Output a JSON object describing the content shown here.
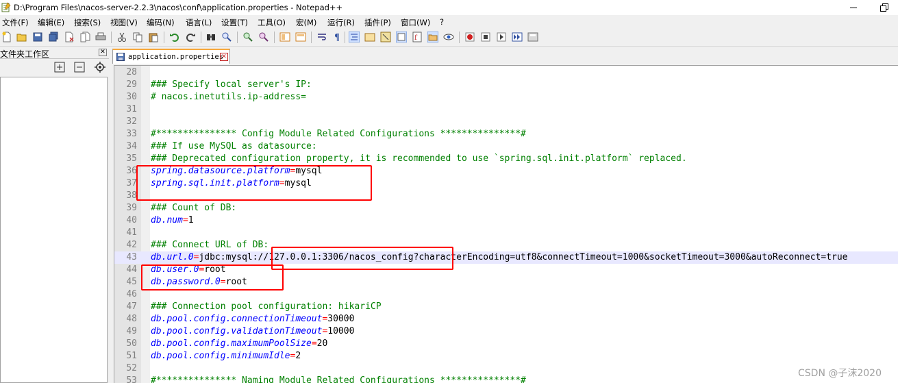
{
  "window": {
    "title": "D:\\Program Files\\nacos-server-2.2.3\\nacos\\conf\\application.properties - Notepad++"
  },
  "menu": [
    "文件(F)",
    "编辑(E)",
    "搜索(S)",
    "视图(V)",
    "编码(N)",
    "语言(L)",
    "设置(T)",
    "工具(O)",
    "宏(M)",
    "运行(R)",
    "插件(P)",
    "窗口(W)",
    "?"
  ],
  "panel": {
    "title": "文件夹工作区",
    "close": "✕"
  },
  "tab": {
    "label": "application.properties",
    "close": "✕"
  },
  "lines": [
    {
      "num": "28",
      "parts": []
    },
    {
      "num": "29",
      "parts": [
        {
          "t": "comment",
          "v": "### Specify local server's IP:"
        }
      ]
    },
    {
      "num": "30",
      "parts": [
        {
          "t": "comment",
          "v": "# nacos.inetutils.ip-address="
        }
      ]
    },
    {
      "num": "31",
      "parts": []
    },
    {
      "num": "32",
      "parts": []
    },
    {
      "num": "33",
      "parts": [
        {
          "t": "comment",
          "v": "#*************** Config Module Related Configurations ***************#"
        }
      ]
    },
    {
      "num": "34",
      "parts": [
        {
          "t": "comment",
          "v": "### If use MySQL as datasource:"
        }
      ]
    },
    {
      "num": "35",
      "parts": [
        {
          "t": "comment",
          "v": "### Deprecated configuration property, it is recommended to use `spring.sql.init.platform` replaced."
        }
      ]
    },
    {
      "num": "36",
      "parts": [
        {
          "t": "key",
          "v": "spring.datasource.platform"
        },
        {
          "t": "eq",
          "v": "="
        },
        {
          "t": "val",
          "v": "mysql"
        }
      ]
    },
    {
      "num": "37",
      "parts": [
        {
          "t": "key",
          "v": "spring.sql.init.platform"
        },
        {
          "t": "eq",
          "v": "="
        },
        {
          "t": "val",
          "v": "mysql"
        }
      ]
    },
    {
      "num": "38",
      "parts": []
    },
    {
      "num": "39",
      "parts": [
        {
          "t": "comment",
          "v": "### Count of DB:"
        }
      ]
    },
    {
      "num": "40",
      "parts": [
        {
          "t": "key",
          "v": "db.num"
        },
        {
          "t": "eq",
          "v": "="
        },
        {
          "t": "val",
          "v": "1"
        }
      ]
    },
    {
      "num": "41",
      "parts": []
    },
    {
      "num": "42",
      "parts": [
        {
          "t": "comment",
          "v": "### Connect URL of DB:"
        }
      ]
    },
    {
      "num": "43",
      "hl": true,
      "parts": [
        {
          "t": "key",
          "v": "db.url.0"
        },
        {
          "t": "eq",
          "v": "="
        },
        {
          "t": "val",
          "v": "jdbc:mysql://127.0.0.1:3306/nacos_config?characterEncoding=utf8&connectTimeout=1000&socketTimeout=3000&autoReconnect=true"
        }
      ]
    },
    {
      "num": "44",
      "parts": [
        {
          "t": "key",
          "v": "db.user.0"
        },
        {
          "t": "eq",
          "v": "="
        },
        {
          "t": "val",
          "v": "root"
        }
      ]
    },
    {
      "num": "45",
      "parts": [
        {
          "t": "key",
          "v": "db.password.0"
        },
        {
          "t": "eq",
          "v": "="
        },
        {
          "t": "val",
          "v": "root"
        }
      ]
    },
    {
      "num": "46",
      "parts": []
    },
    {
      "num": "47",
      "parts": [
        {
          "t": "comment",
          "v": "### Connection pool configuration: hikariCP"
        }
      ]
    },
    {
      "num": "48",
      "parts": [
        {
          "t": "key",
          "v": "db.pool.config.connectionTimeout"
        },
        {
          "t": "eq",
          "v": "="
        },
        {
          "t": "val",
          "v": "30000"
        }
      ]
    },
    {
      "num": "49",
      "parts": [
        {
          "t": "key",
          "v": "db.pool.config.validationTimeout"
        },
        {
          "t": "eq",
          "v": "="
        },
        {
          "t": "val",
          "v": "10000"
        }
      ]
    },
    {
      "num": "50",
      "parts": [
        {
          "t": "key",
          "v": "db.pool.config.maximumPoolSize"
        },
        {
          "t": "eq",
          "v": "="
        },
        {
          "t": "val",
          "v": "20"
        }
      ]
    },
    {
      "num": "51",
      "parts": [
        {
          "t": "key",
          "v": "db.pool.config.minimumIdle"
        },
        {
          "t": "eq",
          "v": "="
        },
        {
          "t": "val",
          "v": "2"
        }
      ]
    },
    {
      "num": "52",
      "parts": []
    },
    {
      "num": "53",
      "parts": [
        {
          "t": "comment",
          "v": "#*************** Naming Module Related Configurations ***************#"
        }
      ]
    }
  ],
  "watermark": "CSDN @子沫2020"
}
